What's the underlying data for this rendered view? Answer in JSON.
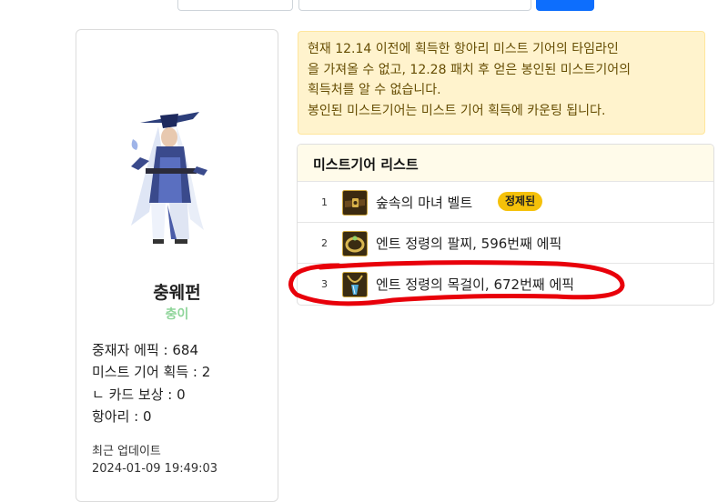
{
  "profile": {
    "name": "충웨펀",
    "subtitle": "충이",
    "stats": [
      "중재자 에픽 : 684",
      "미스트 기어 획득 : 2",
      "ㄴ 카드 보상 : 0",
      "항아리 : 0"
    ],
    "update_label": "최근 업데이트",
    "update_time": "2024-01-09 19:49:03"
  },
  "notice": {
    "lines": [
      "현재 12.14 이전에 획득한 항아리 미스트 기어의 타임라인",
      "을 가져올 수 없고, 12.28 패치 후 얻은 봉인된 미스트기어의",
      "획득처를 알 수 없습니다.",
      "봉인된 미스트기어는 미스트 기어 획득에 카운팅 됩니다."
    ]
  },
  "list": {
    "title": "미스트기어 리스트",
    "items": [
      {
        "num": "1",
        "name": "숲속의 마녀 벨트",
        "badge": "정제된",
        "icon": "belt-icon"
      },
      {
        "num": "2",
        "name": "엔트 정령의 팔찌, 596번째 에픽",
        "icon": "bracelet-icon"
      },
      {
        "num": "3",
        "name": "엔트 정령의 목걸이, 672번째 에픽",
        "icon": "necklace-icon"
      }
    ]
  },
  "colors": {
    "badge": "#f5c10a",
    "notice_bg": "#fff3cd",
    "annotation": "#e8000a",
    "subtitle": "#8fd59a",
    "primary": "#0d6efd"
  }
}
